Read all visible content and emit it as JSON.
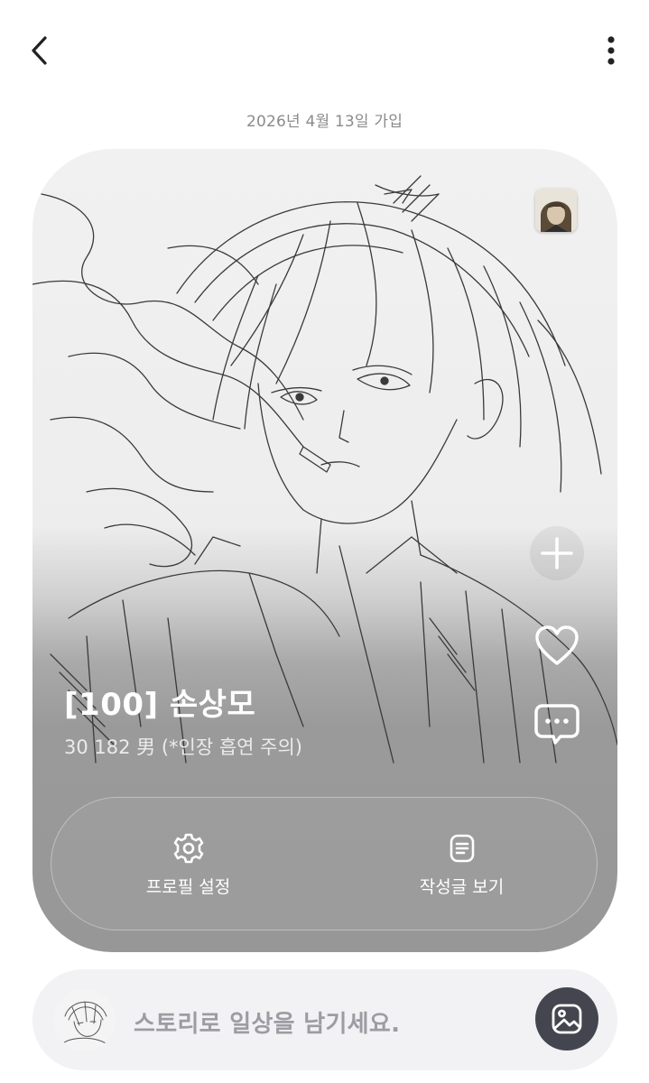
{
  "header": {
    "back_icon": "chevron-left-icon",
    "more_icon": "more-vertical-icon",
    "join_date": "2026년 4월 13일 가입"
  },
  "profile": {
    "name": "[100] 손상모",
    "description": "30 182 男 (*인장 흡연 주의)",
    "side_actions": [
      {
        "icon": "plus-icon",
        "label": "add"
      },
      {
        "icon": "heart-icon",
        "label": "like"
      },
      {
        "icon": "chat-bubble-icon",
        "label": "comment"
      }
    ],
    "actions": [
      {
        "icon": "gear-icon",
        "label": "프로필 설정"
      },
      {
        "icon": "document-icon",
        "label": "작성글 보기"
      }
    ]
  },
  "story": {
    "placeholder": "스토리로 일상을 남기세요.",
    "button_icon": "image-icon"
  },
  "colors": {
    "story_button_bg": "#44464f",
    "story_bar_bg": "#f2f2f4",
    "date_text": "#8b8b8b"
  }
}
